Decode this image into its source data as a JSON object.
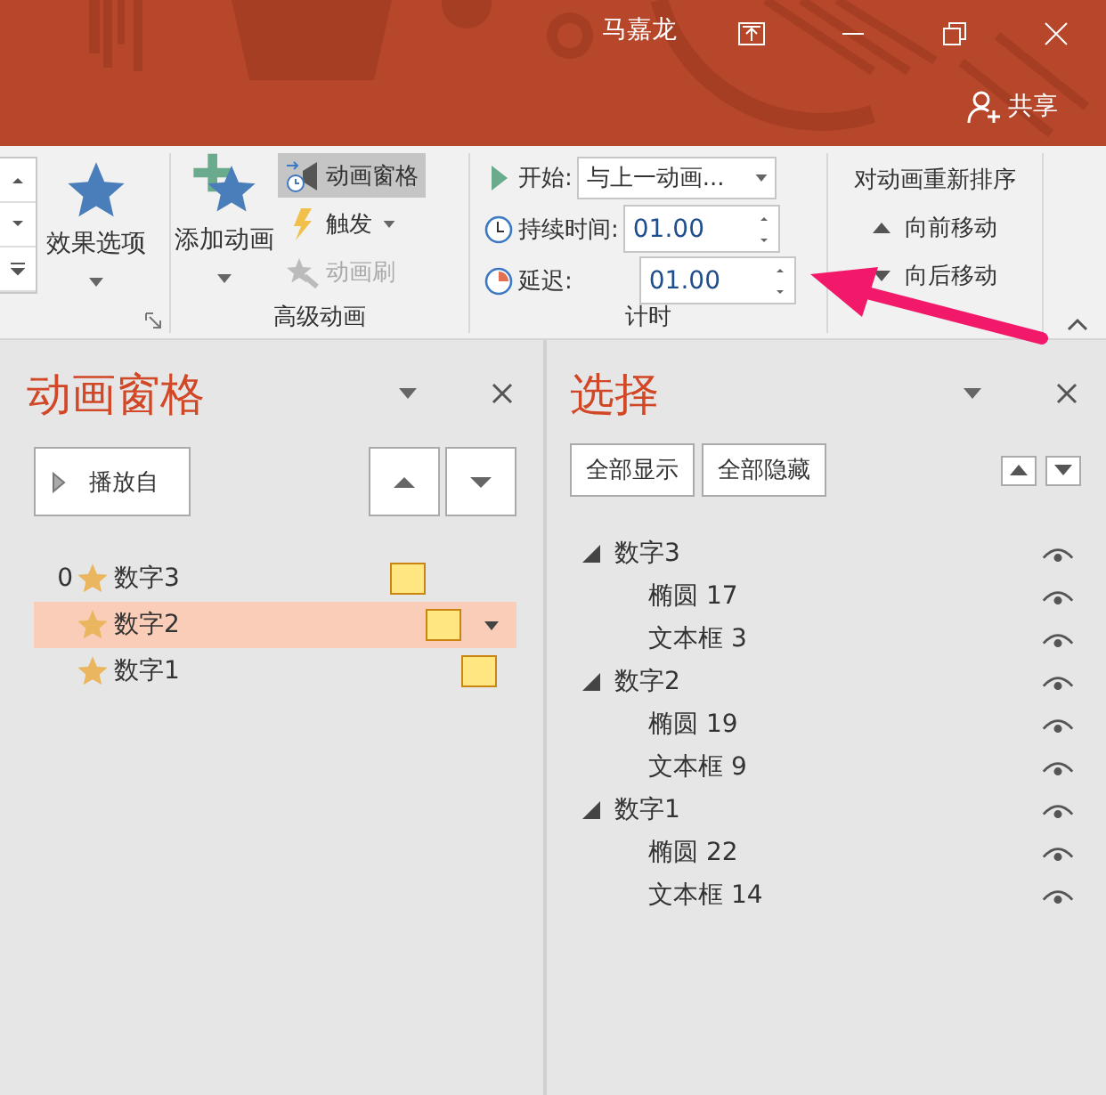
{
  "title_bar": {
    "user": "马嘉龙",
    "share": "共享"
  },
  "ribbon": {
    "effect_options": "效果选项",
    "add_animation": "添加动画",
    "animation_pane_button": {
      "label": "动画窗格",
      "selected": true
    },
    "trigger": "触发",
    "painter": {
      "label": "动画刷",
      "disabled": true
    },
    "advanced_group": "高级动画",
    "timing": {
      "start_label": "开始:",
      "start_value": "与上一动画...",
      "duration_label": "持续时间:",
      "duration_value": "01.00",
      "delay_label": "延迟:",
      "delay_value": "01.00",
      "group": "计时"
    },
    "reorder": {
      "title": "对动画重新排序",
      "move_earlier": "向前移动",
      "move_later": "向后移动"
    }
  },
  "animation_pane": {
    "title": "动画窗格",
    "play_from": "播放自",
    "items": [
      {
        "order": "0",
        "name": "数字3",
        "selected": false
      },
      {
        "name": "数字2",
        "selected": true
      },
      {
        "name": "数字1",
        "selected": false
      }
    ]
  },
  "selection_pane": {
    "title": "选择",
    "show_all": "全部显示",
    "hide_all": "全部隐藏",
    "items": [
      {
        "name": "数字3",
        "expanded": true,
        "visible": true,
        "children": [
          {
            "name": "椭圆 17",
            "visible": true
          },
          {
            "name": "文本框 3",
            "visible": true
          }
        ]
      },
      {
        "name": "数字2",
        "expanded": true,
        "visible": true,
        "children": [
          {
            "name": "椭圆 19",
            "visible": true
          },
          {
            "name": "文本框 9",
            "visible": true
          }
        ]
      },
      {
        "name": "数字1",
        "expanded": true,
        "visible": true,
        "children": [
          {
            "name": "椭圆 22",
            "visible": true
          },
          {
            "name": "文本框 14",
            "visible": true
          }
        ]
      }
    ]
  }
}
